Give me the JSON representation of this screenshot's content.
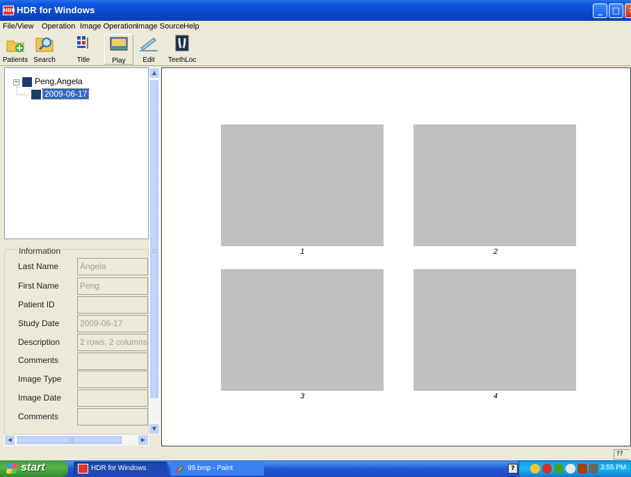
{
  "window": {
    "title": "HDR for Windows",
    "app_icon_text": "HDR",
    "controls": {
      "minimize": "_",
      "maximize": "□",
      "close": "✕"
    }
  },
  "menu": {
    "items": [
      "File/View",
      "Operation",
      "Image Operation",
      "Image Source",
      "Help"
    ]
  },
  "toolbar": {
    "buttons": [
      {
        "label": "Patients",
        "icon": "patients-add-icon"
      },
      {
        "label": "Search",
        "icon": "search-folder-icon"
      },
      {
        "label": "Title",
        "icon": "title-icon"
      },
      {
        "label": "Play",
        "icon": "play-slideshow-icon"
      },
      {
        "label": "Edit",
        "icon": "edit-pencil-icon"
      },
      {
        "label": "TeethLoc",
        "icon": "teeth-xray-icon"
      }
    ]
  },
  "tree": {
    "root_toggle": "−",
    "root_label": "Peng,Angela",
    "child_label": "2009-06-17"
  },
  "info": {
    "legend": "Information",
    "fields": [
      {
        "label": "Last Name",
        "value": "Angela"
      },
      {
        "label": "First Name",
        "value": "Peng"
      },
      {
        "label": "Patient ID",
        "value": ""
      },
      {
        "label": "Study Date",
        "value": "2009-06-17"
      },
      {
        "label": "Description",
        "value": "2 rows, 2 columns"
      },
      {
        "label": "Comments",
        "value": ""
      },
      {
        "label": "Image Type",
        "value": ""
      },
      {
        "label": "Image Date",
        "value": ""
      },
      {
        "label": "Comments",
        "value": ""
      }
    ]
  },
  "scrollbars": {
    "up": "▲",
    "down": "▼",
    "left": "◀",
    "right": "▶"
  },
  "viewer": {
    "thumbnails": [
      {
        "label": "1"
      },
      {
        "label": "2"
      },
      {
        "label": "3"
      },
      {
        "label": "4"
      }
    ]
  },
  "statusbar": {
    "cell_text": "??"
  },
  "taskbar": {
    "start_label": "start",
    "tasks": [
      {
        "label": "HDR for Windows",
        "active": true
      },
      {
        "label": "99.bmp - Paint",
        "active": false
      }
    ],
    "help_tray": "?",
    "clock": "3:55 PM"
  },
  "colors": {
    "titlebar": "#0746c4",
    "thumbnail_gray": "#c0c0c0",
    "selection": "#316ac5",
    "start_green": "#3c9a3c"
  }
}
